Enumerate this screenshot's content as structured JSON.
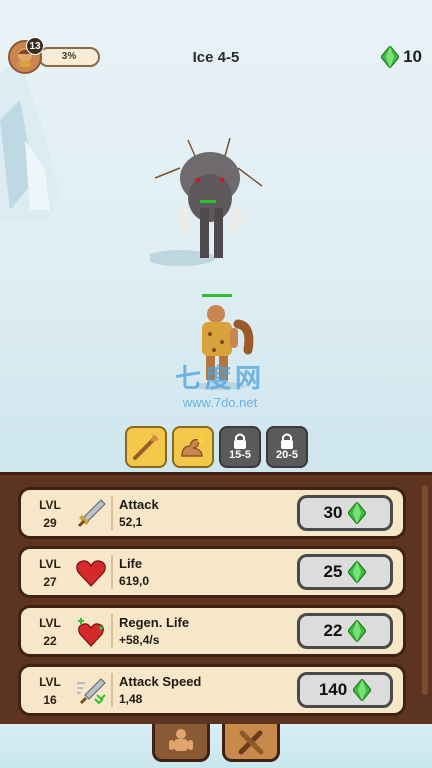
{
  "hud": {
    "player_level": "13",
    "xp_percent_text": "3%",
    "xp_fraction": 0.03,
    "level_name": "Ice 4-5",
    "gems": "10"
  },
  "watermark": {
    "main": "七度网",
    "sub": "www.7do.net"
  },
  "skills": [
    {
      "name": "weapon-skill",
      "state": "unlocked"
    },
    {
      "name": "strength-skill",
      "state": "unlocked"
    },
    {
      "name": "locked-skill-1",
      "state": "locked",
      "label": "15-5"
    },
    {
      "name": "locked-skill-2",
      "state": "locked",
      "label": "20-5"
    }
  ],
  "upgrades": [
    {
      "lvl_label": "LVL",
      "level": "29",
      "icon": "sword-icon",
      "name": "Attack",
      "value": "52,1",
      "cost": "30"
    },
    {
      "lvl_label": "LVL",
      "level": "27",
      "icon": "heart-icon",
      "name": "Life",
      "value": "619,0",
      "cost": "25"
    },
    {
      "lvl_label": "LVL",
      "level": "22",
      "icon": "regen-heart-icon",
      "name": "Regen. Life",
      "value": "+58,4/s",
      "cost": "22"
    },
    {
      "lvl_label": "LVL",
      "level": "16",
      "icon": "attack-speed-icon",
      "name": "Attack Speed",
      "value": "1,48",
      "cost": "140"
    }
  ],
  "bottom_nav": [
    {
      "name": "hero-tab",
      "icon": "caveman-icon",
      "active": true
    },
    {
      "name": "weapons-tab",
      "icon": "crossed-clubs-icon",
      "active": false
    }
  ],
  "colors": {
    "gem": "#3fbf3f",
    "panel": "#5c3420",
    "card": "#f6e7c9",
    "active_skill": "#f3c84a"
  }
}
